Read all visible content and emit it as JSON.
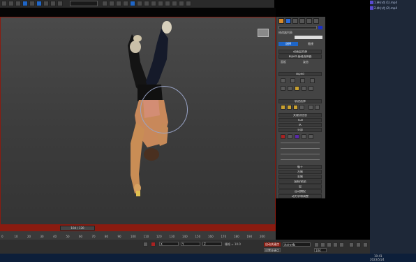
{
  "command_panel": {
    "modifier_list": "修改器列表",
    "mode_buttons": [
      "选择",
      "链接"
    ],
    "rollouts": [
      "动画层资源",
      "Biped 基础选择器",
      "Biped",
      "轨迹选择",
      "关键点信息",
      "TCB",
      "IK",
      "头部",
      "躯干",
      "左臂",
      "右臂",
      "复制/粘贴",
      "层",
      "运动捕捉",
      "动力学和调整"
    ],
    "sub_labels": [
      "面板",
      "姿态"
    ]
  },
  "right_panel": {
    "files": [
      "1.单小花 (1).mp4",
      "2.单小花 (2).mp4"
    ]
  },
  "timeline": {
    "thumb_label": "104 / 120",
    "ticks": [
      "0",
      "10",
      "20",
      "30",
      "40",
      "50",
      "60",
      "70",
      "80",
      "90",
      "100",
      "110",
      "120",
      "130",
      "140",
      "150",
      "160",
      "170",
      "180",
      "190",
      "200"
    ]
  },
  "statusbar": {
    "field_x": "X",
    "field_y": "Y",
    "field_z": "Z",
    "grid": "栅格 = 10.0",
    "auto_key": "自动关键点",
    "set_key": "设置关键点",
    "key_filter": "选定对象",
    "frame": "104"
  },
  "taskbar": {
    "time": "10:41",
    "date": "2023/5/24"
  }
}
